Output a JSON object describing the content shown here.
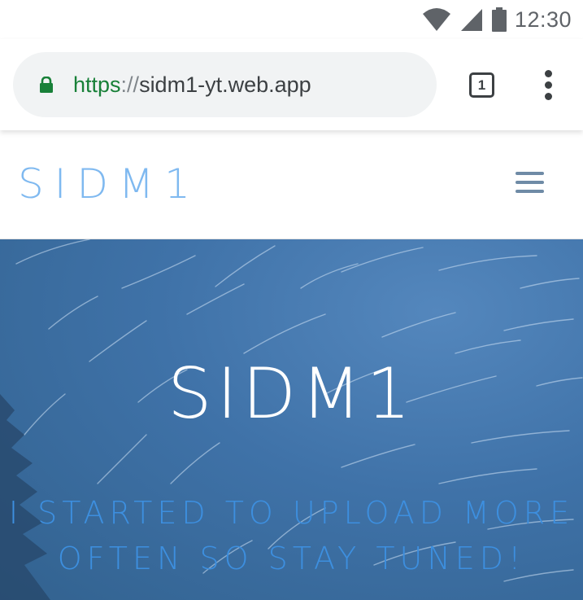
{
  "status_bar": {
    "time": "12:30",
    "icons": [
      "wifi-icon",
      "cell-signal-icon",
      "battery-icon"
    ]
  },
  "browser": {
    "url_scheme": "https",
    "url_separator": "://",
    "url_host": "sidm1-yt.web.app",
    "tab_count": "1",
    "icons": [
      "lock-icon",
      "tab-switcher-icon",
      "more-vert-icon"
    ]
  },
  "site": {
    "brand": "SIDM1",
    "menu_icon": "hamburger-menu-icon",
    "hero_title": "SIDM1",
    "hero_subtitle_line1": "I STARTED TO UPLOAD MORE",
    "hero_subtitle_line2": "OFTEN SO STAY TUNED!"
  },
  "colors": {
    "url_scheme": "#188038",
    "brand": "#7fb9f0",
    "hero_background": "#3f72a8",
    "hero_subtitle": "#3d8fdf"
  }
}
